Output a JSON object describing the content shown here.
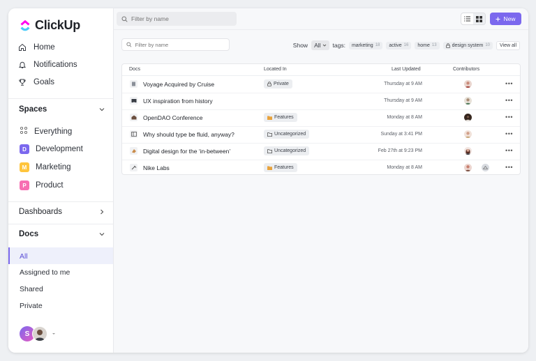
{
  "app": {
    "name": "ClickUp"
  },
  "sidebar": {
    "nav": [
      {
        "label": "Home",
        "icon": "home-icon"
      },
      {
        "label": "Notifications",
        "icon": "bell-icon"
      },
      {
        "label": "Goals",
        "icon": "trophy-icon"
      }
    ],
    "spaces_header": "Spaces",
    "spaces": [
      {
        "label": "Everything",
        "icon": "grid-dots-icon"
      },
      {
        "label": "Development",
        "letter": "D",
        "color": "#7b68ee"
      },
      {
        "label": "Marketing",
        "letter": "M",
        "color": "#ffc53d"
      },
      {
        "label": "Product",
        "letter": "P",
        "color": "#f76eb2"
      }
    ],
    "dashboards_label": "Dashboards",
    "docs_header": "Docs",
    "docs": [
      {
        "label": "All",
        "active": true
      },
      {
        "label": "Assigned to me"
      },
      {
        "label": "Shared"
      },
      {
        "label": "Private"
      }
    ],
    "user_initial": "S"
  },
  "topbar": {
    "search_placeholder": "Filter by name",
    "new_label": "New",
    "accent": "#7b68ee"
  },
  "filters": {
    "search_placeholder": "Filter by name",
    "show_label": "Show",
    "show_value": "All",
    "tags_label": "tags:",
    "tags": [
      {
        "name": "marketing",
        "count": "18"
      },
      {
        "name": "active",
        "count": "16"
      },
      {
        "name": "home",
        "count": "13"
      },
      {
        "name": "design system",
        "count": "10",
        "locked": true
      }
    ],
    "view_all": "View all"
  },
  "table": {
    "headers": {
      "docs": "Docs",
      "location": "Located In",
      "updated": "Last Updated",
      "contributors": "Contributors"
    },
    "rows": [
      {
        "title": "Voyage Acquired by Cruise",
        "location": "Private",
        "loc_icon": "lock-icon",
        "updated": "Thursday at 9 AM",
        "contrib": [
          "#c98b7a"
        ]
      },
      {
        "title": "UX inspiration from history",
        "location": "",
        "loc_icon": "",
        "updated": "Thursday at 9 AM",
        "contrib": [
          "#a98c76"
        ]
      },
      {
        "title": "OpenDAO Conference",
        "location": "Features",
        "loc_icon": "folder-icon",
        "updated": "Monday at 8 AM",
        "contrib": [
          "#6b4f3f"
        ]
      },
      {
        "title": "Why should type be fluid, anyway?",
        "location": "Uncategorized",
        "loc_icon": "folder-outline-icon",
        "updated": "Sunday at 3:41 PM",
        "contrib": [
          "#d1a08a"
        ]
      },
      {
        "title": "Digital design for the ‘in-between’",
        "location": "Uncategorized",
        "loc_icon": "folder-outline-icon",
        "updated": "Feb 27th at 9:23 PM",
        "contrib": [
          "#b8735f"
        ]
      },
      {
        "title": "Nike Labs",
        "location": "Features",
        "loc_icon": "folder-icon",
        "updated": "Monday at 8 AM",
        "contrib": [
          "#c77e6e",
          "#d8dbe0"
        ]
      }
    ]
  }
}
